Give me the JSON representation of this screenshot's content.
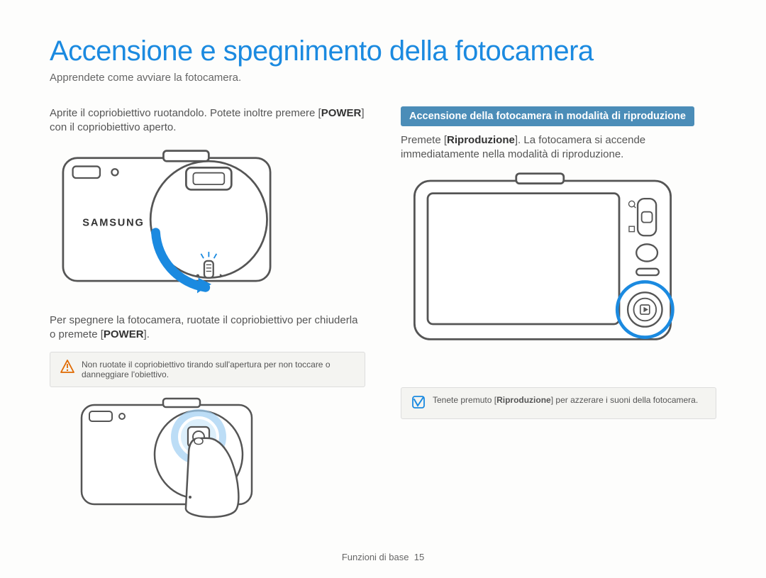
{
  "title": "Accensione e spegnimento della fotocamera",
  "subtitle": "Apprendete come avviare la fotocamera.",
  "left": {
    "para1_a": "Aprite il copriobiettivo ruotandolo. Potete inoltre premere [",
    "para1_power": "POWER",
    "para1_b": "] con il copriobiettivo aperto.",
    "para2_a": "Per spegnere la fotocamera, ruotate il copriobiettivo per chiuderla o premete [",
    "para2_power": "POWER",
    "para2_b": "].",
    "warning": "Non ruotate il copriobiettivo tirando sull'apertura per non toccare o danneggiare l'obiettivo.",
    "brand": "SAMSUNG"
  },
  "right": {
    "banner": "Accensione della fotocamera in modalità di riproduzione",
    "para_a": "Premete [",
    "para_ripro": "Riproduzione",
    "para_b": "]. La fotocamera si accende immediatamente nella modalità di riproduzione.",
    "tip_a": "Tenete premuto [",
    "tip_ripro": "Riproduzione",
    "tip_b": "] per azzerare i suoni della fotocamera."
  },
  "footer_label": "Funzioni di base",
  "footer_page": "15"
}
